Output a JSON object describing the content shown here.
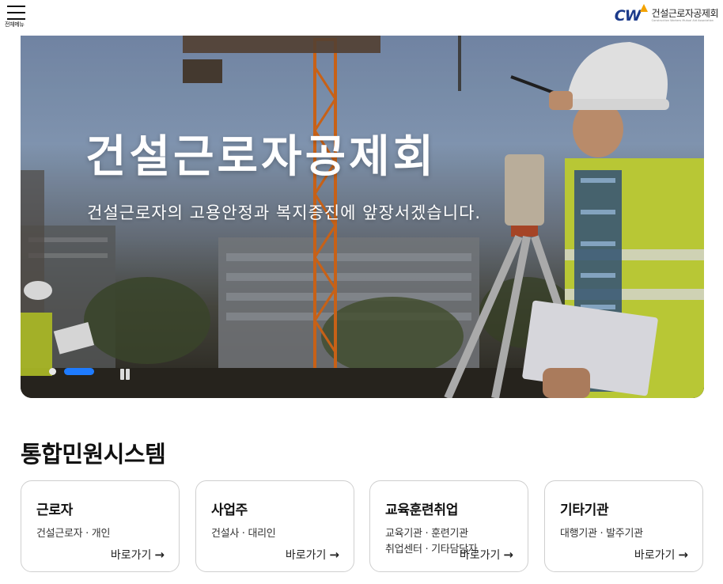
{
  "header": {
    "menu_label": "전체메뉴",
    "logo_mark": "CW",
    "logo_name": "건설근로자공제회",
    "logo_tagline": "Construction Workers Mutual Aid Association"
  },
  "hero": {
    "title": "건설근로자공제회",
    "subtitle": "건설근로자의 고용안정과 복지증진에 앞장서겠습니다.",
    "slide_count": 2,
    "active_slide": 2
  },
  "section": {
    "title": "통합민원시스템"
  },
  "cards": [
    {
      "title": "근로자",
      "desc": "건설근로자 · 개인",
      "desc2": "",
      "link": "바로가기"
    },
    {
      "title": "사업주",
      "desc": "건설사 · 대리인",
      "desc2": "",
      "link": "바로가기"
    },
    {
      "title": "교육훈련취업",
      "desc": "교육기관 · 훈련기관",
      "desc2": "취업센터 · 기타담당자",
      "link": "바로가기"
    },
    {
      "title": "기타기관",
      "desc": "대행기관 · 발주기관",
      "desc2": "",
      "link": "바로가기"
    }
  ],
  "colors": {
    "accent": "#1e7bff",
    "logo_blue": "#1b3a8a",
    "logo_orange": "#f4a300"
  }
}
